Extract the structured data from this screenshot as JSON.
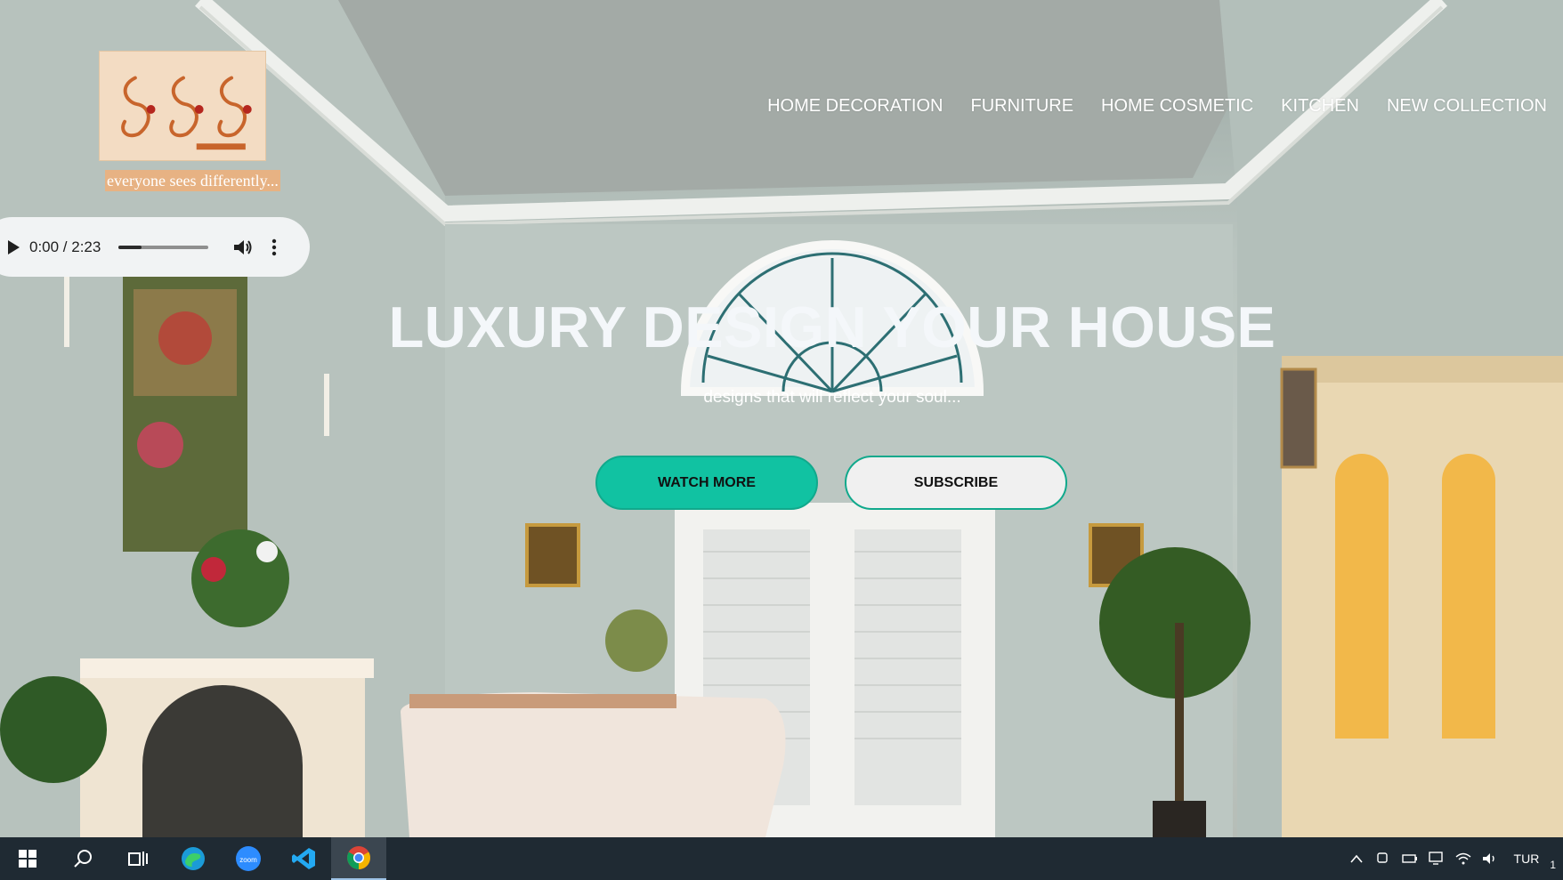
{
  "logo": {
    "tagline": "everyone sees differently..."
  },
  "audio": {
    "time": "0:00 / 2:23",
    "progress": 0.25
  },
  "nav": {
    "items": [
      "HOME DECORATION",
      "FURNITURE",
      "HOME COSMETIC",
      "KITCHEN",
      "NEW COLLECTION"
    ]
  },
  "hero": {
    "title": "LUXURY DESIGN YOUR HOUSE",
    "subtitle": "designs that will reflect your soul...",
    "watch_label": "WATCH MORE",
    "subscribe_label": "SUBSCRIBE"
  },
  "taskbar": {
    "apps": [
      "windows-start-icon",
      "search-icon",
      "task-view-icon",
      "edge-icon",
      "zoom-icon",
      "vscode-icon",
      "chrome-icon"
    ],
    "language": "TUR",
    "clock": "1"
  },
  "colors": {
    "accent": "#11c2a2",
    "taskbar": "#1f2a33"
  }
}
